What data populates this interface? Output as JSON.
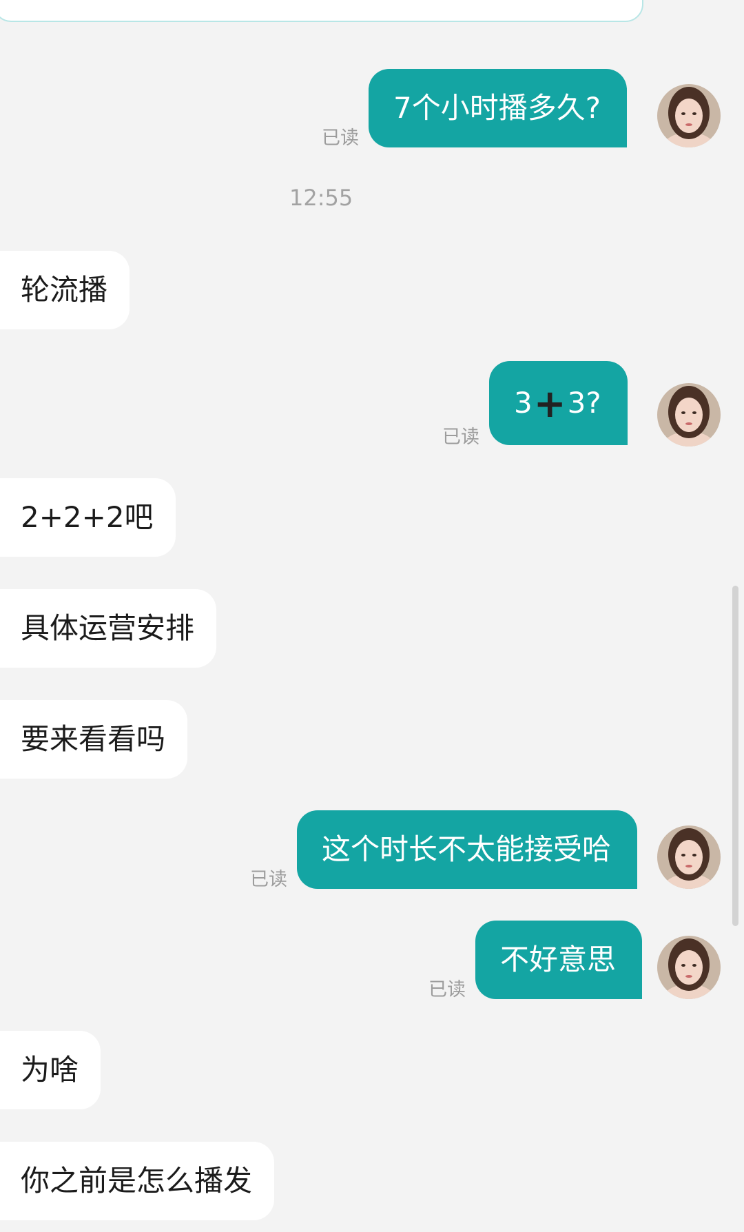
{
  "chat": {
    "timestamp": "12:55",
    "read_label": "已读",
    "colors": {
      "outgoing_bubble": "#14a5a3",
      "incoming_bubble": "#ffffff",
      "background": "#f3f3f3"
    },
    "messages": [
      {
        "side": "out",
        "text": "7个小时播多久?",
        "read": "已读"
      },
      {
        "side": "in",
        "text": "轮流播"
      },
      {
        "side": "out",
        "text_a": "3",
        "text_b": "3?",
        "read": "已读"
      },
      {
        "side": "in",
        "text": "2+2+2吧"
      },
      {
        "side": "in",
        "text": "具体运营安排"
      },
      {
        "side": "in",
        "text": "要来看看吗"
      },
      {
        "side": "out",
        "text": "这个时长不太能接受哈",
        "read": "已读"
      },
      {
        "side": "out",
        "text": "不好意思",
        "read": "已读"
      },
      {
        "side": "in",
        "text": "为啥"
      },
      {
        "side": "in",
        "text": "你之前是怎么播发"
      }
    ]
  }
}
